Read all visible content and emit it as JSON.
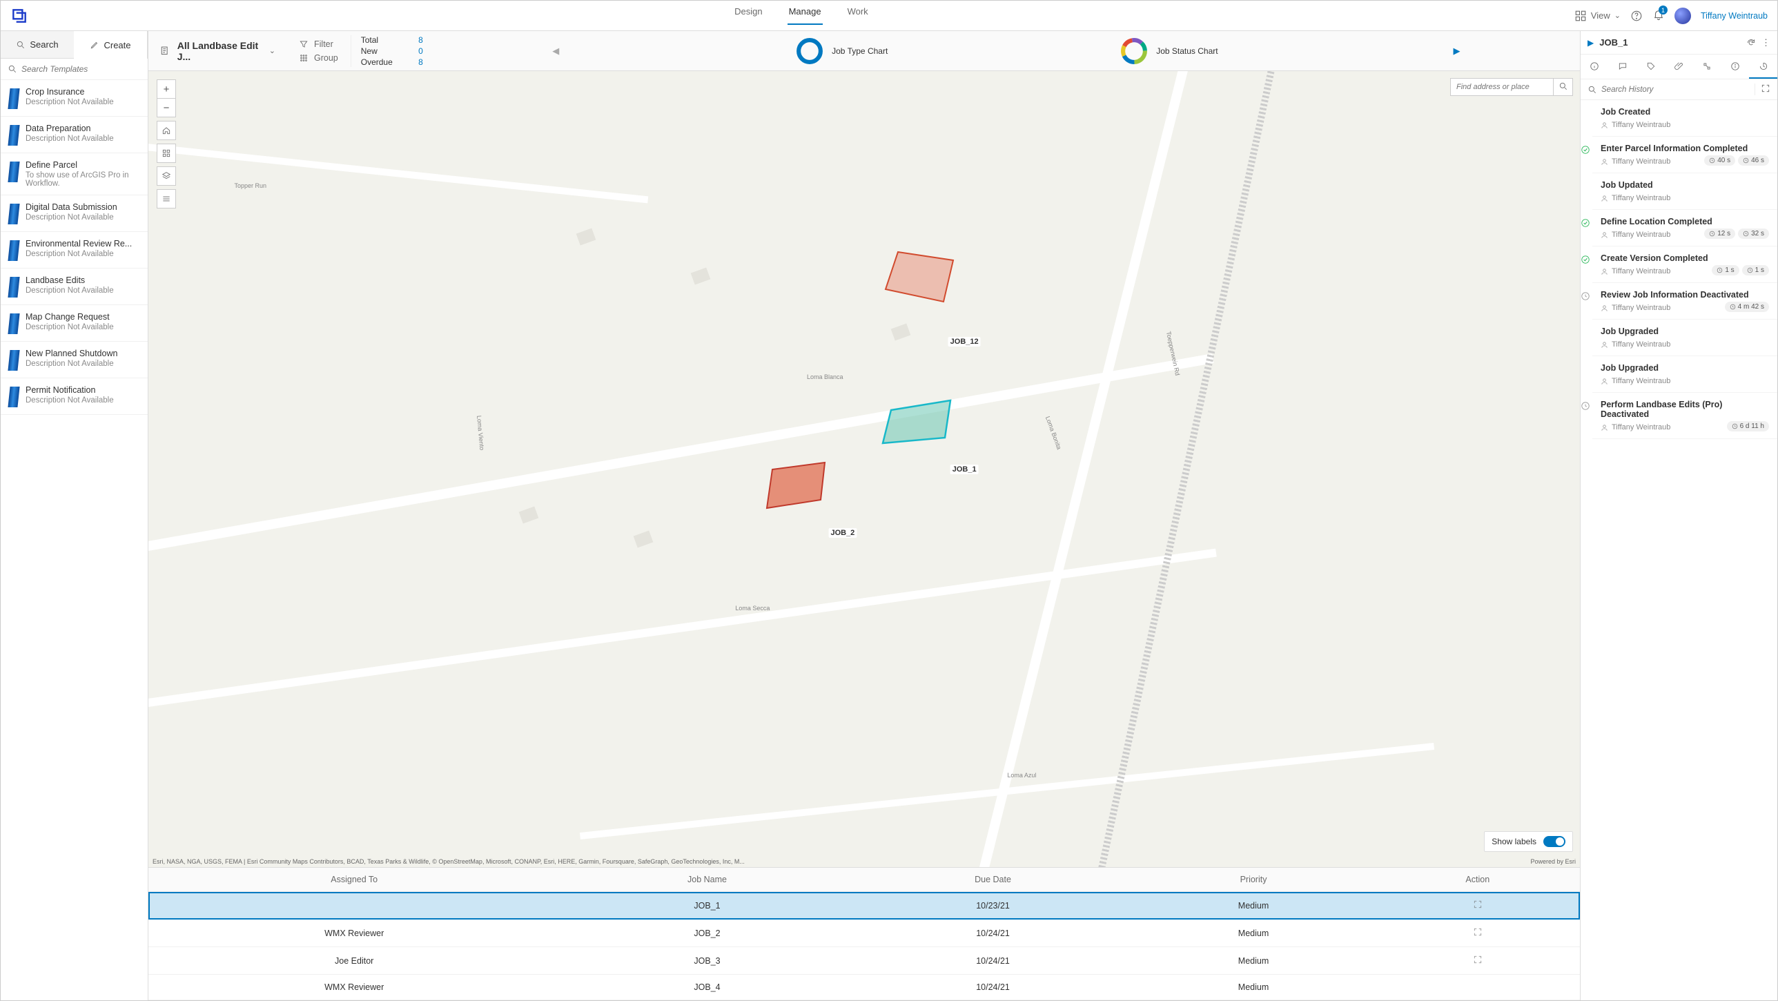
{
  "header": {
    "nav": [
      "Design",
      "Manage",
      "Work"
    ],
    "active_nav": 1,
    "view_label": "View",
    "notification_count": "1",
    "user_name": "Tiffany Weintraub"
  },
  "left": {
    "tabs": {
      "search": "Search",
      "create": "Create"
    },
    "search_placeholder": "Search Templates",
    "templates": [
      {
        "title": "Crop Insurance",
        "desc": "Description Not Available"
      },
      {
        "title": "Data Preparation",
        "desc": "Description Not Available"
      },
      {
        "title": "Define Parcel",
        "desc": "To show use of ArcGIS Pro in Workflow."
      },
      {
        "title": "Digital Data Submission",
        "desc": "Description Not Available"
      },
      {
        "title": "Environmental Review Re...",
        "desc": "Description Not Available"
      },
      {
        "title": "Landbase Edits",
        "desc": "Description Not Available"
      },
      {
        "title": "Map Change Request",
        "desc": "Description Not Available"
      },
      {
        "title": "New Planned Shutdown",
        "desc": "Description Not Available"
      },
      {
        "title": "Permit Notification",
        "desc": "Description Not Available"
      }
    ]
  },
  "toolbar": {
    "job_type": "All Landbase Edit J...",
    "filter": "Filter",
    "group": "Group",
    "stats": {
      "total_l": "Total",
      "total_v": "8",
      "new_l": "New",
      "new_v": "0",
      "over_l": "Overdue",
      "over_v": "8"
    },
    "chart1": "Job Type Chart",
    "chart2": "Job Status Chart"
  },
  "map": {
    "search_placeholder": "Find address or place",
    "show_labels": "Show labels",
    "jobs": {
      "j1": "JOB_1",
      "j2": "JOB_2",
      "j12": "JOB_12"
    },
    "streets": {
      "topper": "Topper Run",
      "blanca": "Loma Blanca",
      "secca": "Loma Secca",
      "azul": "Loma Azul",
      "bonita": "Loma Bonita",
      "viento": "Loma Viento",
      "topper_rd": "Toepperwein Rd"
    },
    "attribution_left": "Esri, NASA, NGA, USGS, FEMA | Esri Community Maps Contributors, BCAD, Texas Parks & Wildlife, © OpenStreetMap, Microsoft, CONANP, Esri, HERE, Garmin, Foursquare, SafeGraph, GeoTechnologies, Inc, M...",
    "attribution_right": "Powered by Esri"
  },
  "table": {
    "cols": [
      "Assigned To",
      "Job Name",
      "Due Date",
      "Priority",
      "Action"
    ],
    "rows": [
      {
        "assigned": "",
        "name": "JOB_1",
        "due": "10/23/21",
        "priority": "Medium",
        "action": true,
        "sel": true
      },
      {
        "assigned": "WMX Reviewer",
        "name": "JOB_2",
        "due": "10/24/21",
        "priority": "Medium",
        "action": true
      },
      {
        "assigned": "Joe Editor",
        "name": "JOB_3",
        "due": "10/24/21",
        "priority": "Medium",
        "action": true
      },
      {
        "assigned": "WMX Reviewer",
        "name": "JOB_4",
        "due": "10/24/21",
        "priority": "Medium",
        "action": false
      }
    ]
  },
  "right": {
    "title": "JOB_1",
    "search_placeholder": "Search History",
    "history": [
      {
        "t": "Job Created",
        "u": "Tiffany Weintraub",
        "status": "",
        "tags": []
      },
      {
        "t": "Enter Parcel Information Completed",
        "u": "Tiffany Weintraub",
        "status": "ok",
        "tags": [
          "40 s",
          "46 s"
        ]
      },
      {
        "t": "Job Updated",
        "u": "Tiffany Weintraub",
        "status": "",
        "tags": []
      },
      {
        "t": "Define Location Completed",
        "u": "Tiffany Weintraub",
        "status": "ok",
        "tags": [
          "12 s",
          "32 s"
        ]
      },
      {
        "t": "Create Version Completed",
        "u": "Tiffany Weintraub",
        "status": "ok",
        "tags": [
          "1 s",
          "1 s"
        ]
      },
      {
        "t": "Review Job Information Deactivated",
        "u": "Tiffany Weintraub",
        "status": "pend",
        "tags": [
          "4 m 42 s"
        ]
      },
      {
        "t": "Job Upgraded",
        "u": "Tiffany Weintraub",
        "status": "",
        "tags": []
      },
      {
        "t": "Job Upgraded",
        "u": "Tiffany Weintraub",
        "status": "",
        "tags": []
      },
      {
        "t": "Perform Landbase Edits (Pro) Deactivated",
        "u": "Tiffany Weintraub",
        "status": "pend",
        "tags": [
          "6 d 11 h"
        ]
      }
    ]
  }
}
